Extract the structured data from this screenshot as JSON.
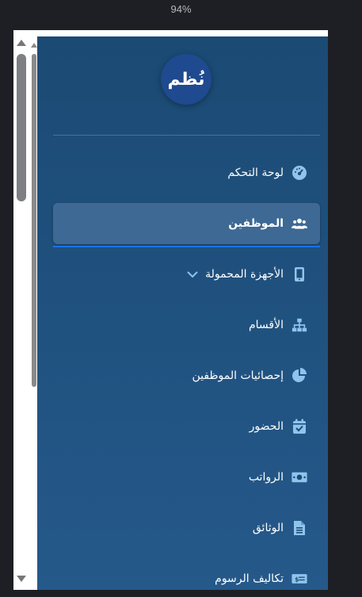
{
  "zoom": "94%",
  "logo": {
    "text": "نُظم"
  },
  "menu": {
    "items": [
      {
        "label": "لوحة التحكم",
        "icon": "dashboard-gauge-icon"
      },
      {
        "label": "الموظفين",
        "icon": "users-group-icon",
        "active": true
      },
      {
        "label": "الأجهزة المحمولة",
        "icon": "mobile-phone-icon",
        "has_submenu": true
      },
      {
        "label": "الأقسام",
        "icon": "sitemap-icon"
      },
      {
        "label": "إحصائيات الموظفين",
        "icon": "pie-chart-icon"
      },
      {
        "label": "الحضور",
        "icon": "calendar-check-icon"
      },
      {
        "label": "الرواتب",
        "icon": "money-bill-icon"
      },
      {
        "label": "الوثائق",
        "icon": "document-icon"
      },
      {
        "label": "تكاليف الرسوم",
        "icon": "fee-card-icon"
      }
    ]
  },
  "colors": {
    "sidebar_top": "#1b4a74",
    "sidebar_bottom": "#25598a",
    "icon": "#8fc4ec",
    "active_bg": "#3e6994",
    "active_underline": "#1a73e8",
    "logo_bg": "#1f4a8f"
  }
}
